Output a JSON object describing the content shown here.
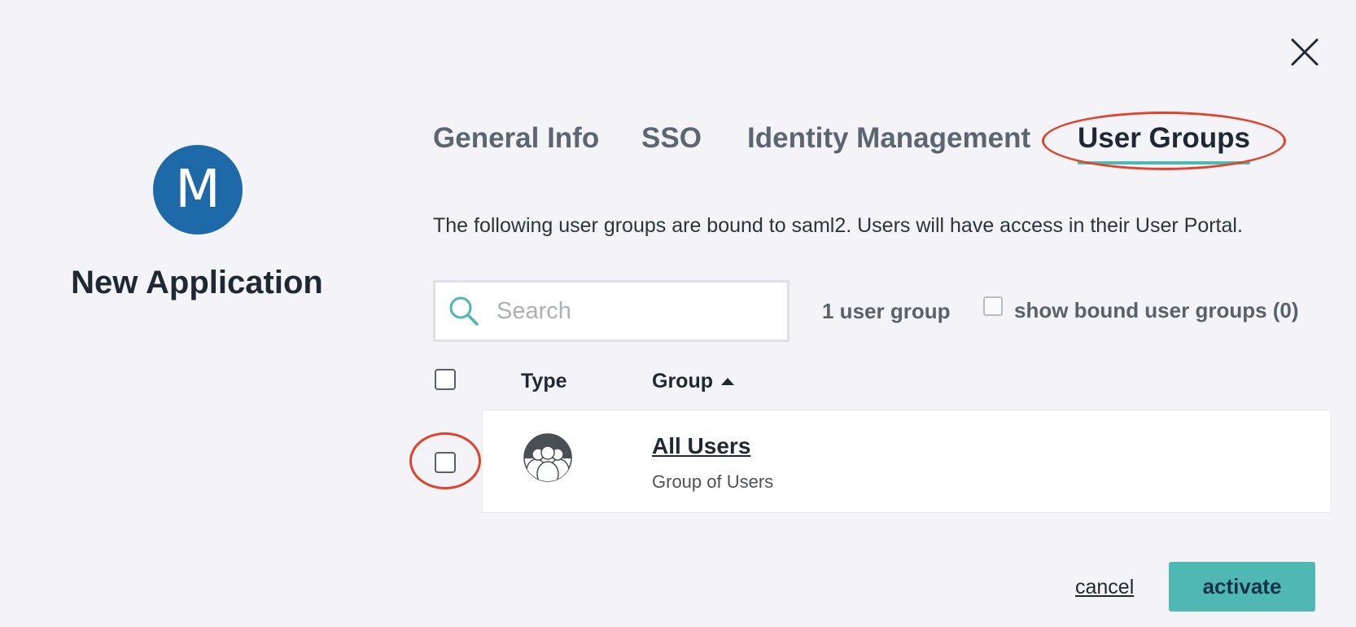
{
  "app": {
    "avatar_letter": "M",
    "name": "New Application"
  },
  "tabs": [
    {
      "label": "General Info",
      "active": false
    },
    {
      "label": "SSO",
      "active": false
    },
    {
      "label": "Identity Management",
      "active": false
    },
    {
      "label": "User Groups",
      "active": true
    }
  ],
  "description": "The following user groups are bound to saml2. Users will have access in their User Portal.",
  "search": {
    "placeholder": "Search",
    "value": ""
  },
  "group_count": "1 user group",
  "show_bound": {
    "label": "show bound user groups (0)",
    "checked": false
  },
  "table": {
    "columns": [
      "Type",
      "Group"
    ],
    "sort_column": "Group",
    "sort_direction": "ascending",
    "rows": [
      {
        "name": "All Users",
        "subtitle": "Group of Users",
        "checked": false,
        "type_icon": "user-group-icon"
      }
    ]
  },
  "footer": {
    "cancel_label": "cancel",
    "activate_label": "activate"
  },
  "colors": {
    "accent": "#4fb8b2",
    "avatar_bg": "#1e6aa8",
    "annotation": "#e0442c",
    "background": "#f4f4f8"
  }
}
